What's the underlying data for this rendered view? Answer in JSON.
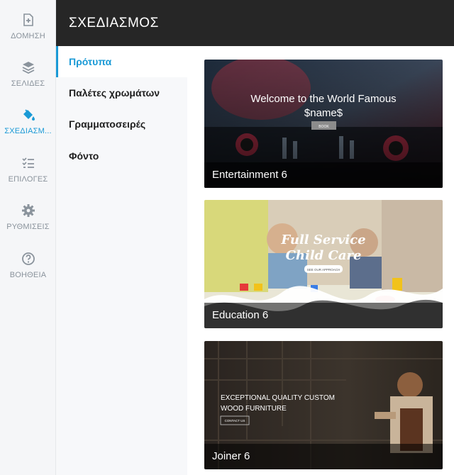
{
  "rail": {
    "items": [
      {
        "label": "ΔΟΜΗΣΗ",
        "icon": "add-page-icon"
      },
      {
        "label": "ΣΕΛΙΔΕΣ",
        "icon": "layers-icon"
      },
      {
        "label": "ΣΧΕΔΙΑΣΜ...",
        "icon": "paint-bucket-icon"
      },
      {
        "label": "ΕΠΙΛΟΓΕΣ",
        "icon": "checklist-icon"
      },
      {
        "label": "ΡΥΘΜΙΣΕΙΣ",
        "icon": "gear-icon"
      },
      {
        "label": "ΒΟΗΘΕΙΑ",
        "icon": "help-icon"
      }
    ],
    "active_index": 2,
    "accent": "#1a9ad6"
  },
  "header": {
    "title": "ΣΧΕΔΙΑΣΜΟΣ"
  },
  "subnav": {
    "items": [
      {
        "label": "Πρότυπα"
      },
      {
        "label": "Παλέτες χρωμάτων"
      },
      {
        "label": "Γραμματοσειρές"
      },
      {
        "label": "Φόντο"
      }
    ],
    "active_index": 0
  },
  "templates": [
    {
      "name": "Entertainment 6",
      "preview": {
        "headline_1": "Welcome to the World Famous",
        "headline_2": "$name$",
        "button": "BOOK"
      }
    },
    {
      "name": "Education 6",
      "preview": {
        "headline_1": "Full Service",
        "headline_2": "Child Care",
        "button": "SEE OUR APPROACH"
      }
    },
    {
      "name": "Joiner 6",
      "preview": {
        "headline_1": "EXCEPTIONAL QUALITY CUSTOM",
        "headline_2": "WOOD FURNITURE",
        "button": "CONTACT US"
      }
    }
  ]
}
